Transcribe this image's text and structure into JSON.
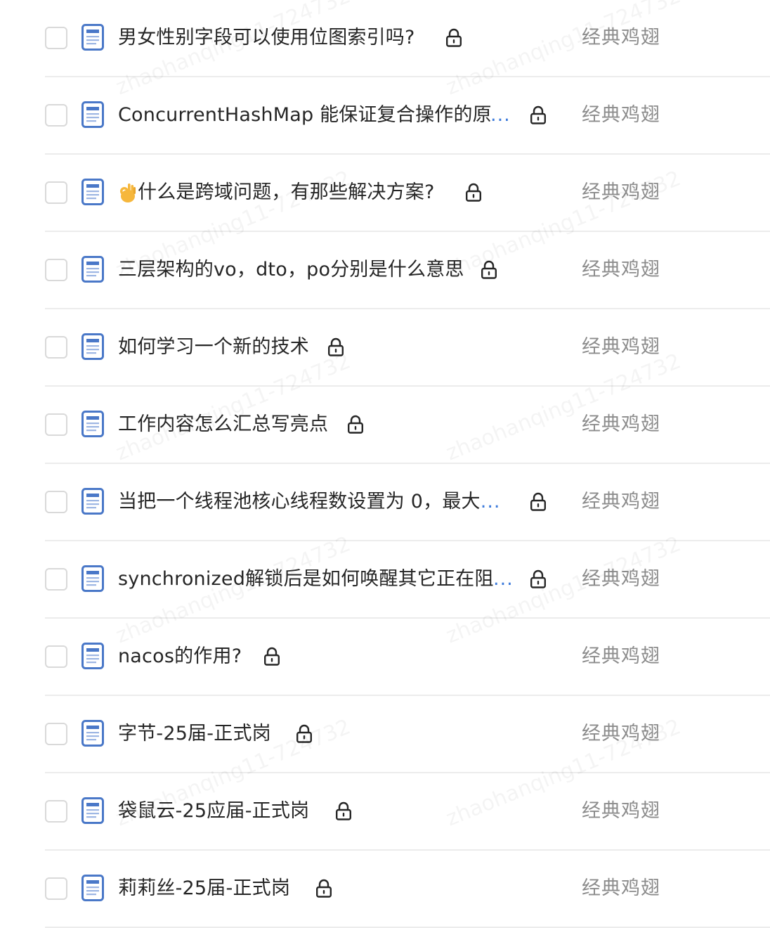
{
  "rows": [
    {
      "title": "男女性别字段可以使用位图索引吗?",
      "ellipsis": "",
      "author": "经典鸡翅"
    },
    {
      "title": "ConcurrentHashMap 能保证复合操作的原",
      "ellipsis": "...",
      "author": "经典鸡翅"
    },
    {
      "emoji": "ok-hand-emoji",
      "title": "什么是跨域问题，有那些解决方案?",
      "ellipsis": "",
      "author": "经典鸡翅"
    },
    {
      "title": "三层架构的vo，dto，po分别是什么意思",
      "ellipsis": "",
      "author": "经典鸡翅"
    },
    {
      "title": "如何学习一个新的技术",
      "ellipsis": "",
      "author": "经典鸡翅"
    },
    {
      "title": "工作内容怎么汇总写亮点",
      "ellipsis": "",
      "author": "经典鸡翅"
    },
    {
      "title": "当把一个线程池核心线程数设置为 0，最大",
      "ellipsis": "...",
      "author": "经典鸡翅"
    },
    {
      "title": "synchronized解锁后是如何唤醒其它正在阻",
      "ellipsis": "...",
      "author": "经典鸡翅"
    },
    {
      "title": "nacos的作用?",
      "ellipsis": "",
      "author": "经典鸡翅"
    },
    {
      "title": "字节-25届-正式岗",
      "ellipsis": "",
      "author": "经典鸡翅"
    },
    {
      "title": "袋鼠云-25应届-正式岗",
      "ellipsis": "",
      "author": "经典鸡翅"
    },
    {
      "title": "莉莉丝-25届-正式岗",
      "ellipsis": "",
      "author": "经典鸡翅"
    }
  ],
  "watermark": "zhaohanqing11-724732",
  "colors": {
    "doc_icon": "#4a78c8",
    "ellipsis": "#3d7bdb",
    "author": "#8c8c8c",
    "divider": "#ececec",
    "checkbox_border": "#d9d9d9"
  },
  "icons": {
    "document": "document-icon",
    "lock": "lock-icon"
  }
}
